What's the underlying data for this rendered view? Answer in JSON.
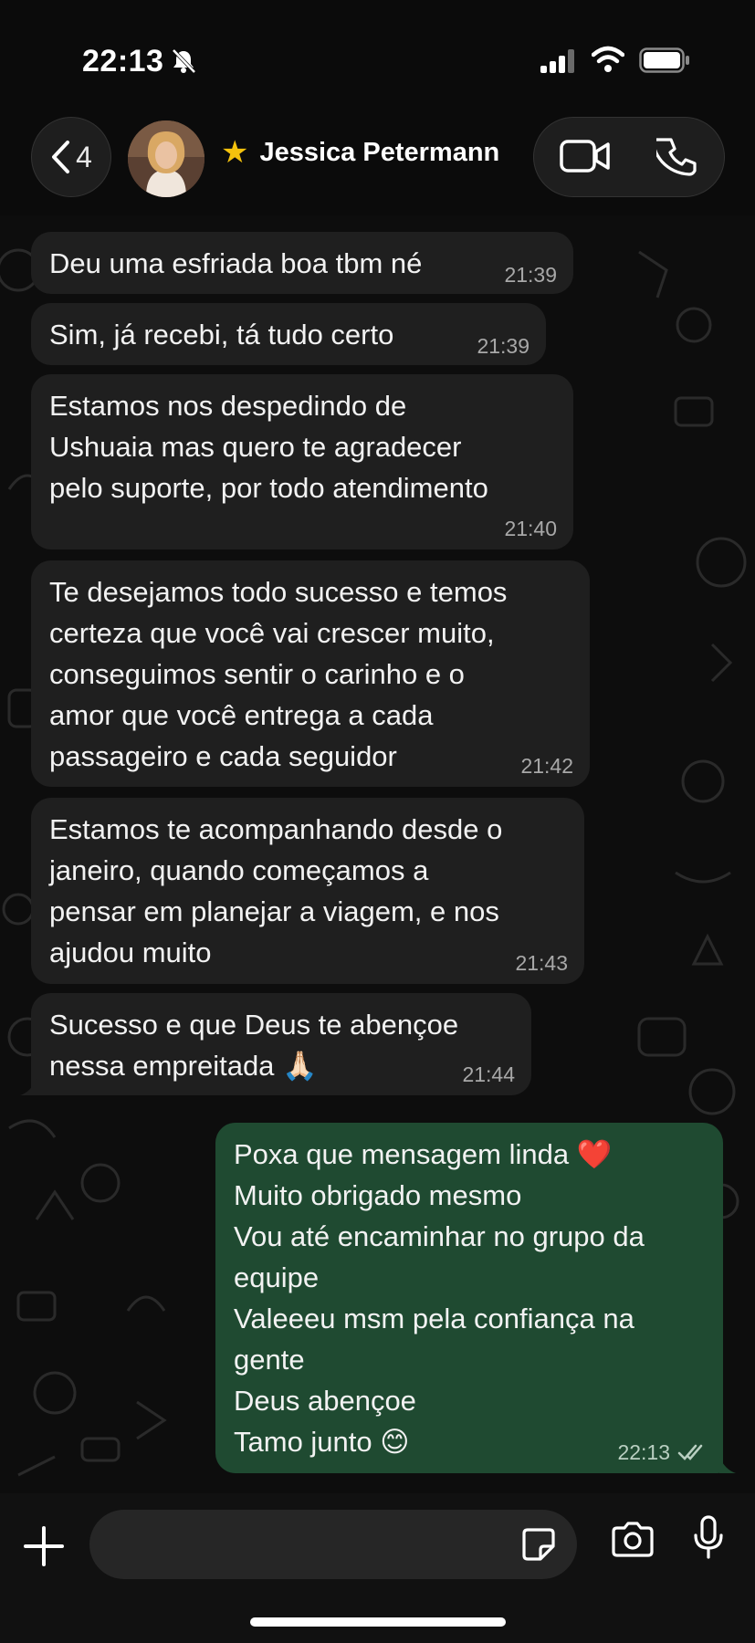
{
  "status_bar": {
    "time": "22:13",
    "icons": [
      "bell-slash-icon",
      "signal-icon",
      "wifi-icon",
      "battery-icon"
    ]
  },
  "header": {
    "back_count": "4",
    "contact_name": "Jessica Petermann",
    "favorite_icon": "star-icon",
    "actions": [
      "video-call-icon",
      "phone-icon"
    ]
  },
  "messages": [
    {
      "direction": "in",
      "text": "Deu uma esfriada boa tbm né",
      "time": "21:39"
    },
    {
      "direction": "in",
      "text": "Sim, já recebi, tá tudo certo",
      "time": "21:39"
    },
    {
      "direction": "in",
      "text": "Estamos nos despedindo de\nUshuaia mas quero te agradecer\npelo suporte, por todo atendimento",
      "time": "21:40"
    },
    {
      "direction": "in",
      "text": "Te desejamos todo sucesso e temos\ncerteza que você vai crescer muito,\nconseguimos sentir o carinho e o\namor que você entrega a cada\npassageiro e cada seguidor",
      "time": "21:42"
    },
    {
      "direction": "in",
      "text": "Estamos te acompanhando desde o\njaneiro, quando começamos a\npensar em planejar a viagem, e nos\najudou muito",
      "time": "21:43"
    },
    {
      "direction": "in",
      "text": "Sucesso e que Deus te abençoe\nnessa empreitada 🙏🏻",
      "time": "21:44"
    },
    {
      "direction": "out",
      "text": "Poxa que mensagem linda ❤️\nMuito obrigado mesmo\nVou até encaminhar no grupo da\nequipe\nValeeeu msm pela confiança na\ngente\nDeus abençoe\nTamo junto 😊",
      "time": "22:13",
      "status": "read"
    }
  ],
  "composer": {
    "placeholder": "",
    "icons": [
      "plus-icon",
      "sticker-icon",
      "camera-icon",
      "microphone-icon"
    ]
  },
  "colors": {
    "incoming_bubble": "#1f1f1f",
    "outgoing_bubble": "#1f4a31",
    "star": "#f4c20d"
  }
}
